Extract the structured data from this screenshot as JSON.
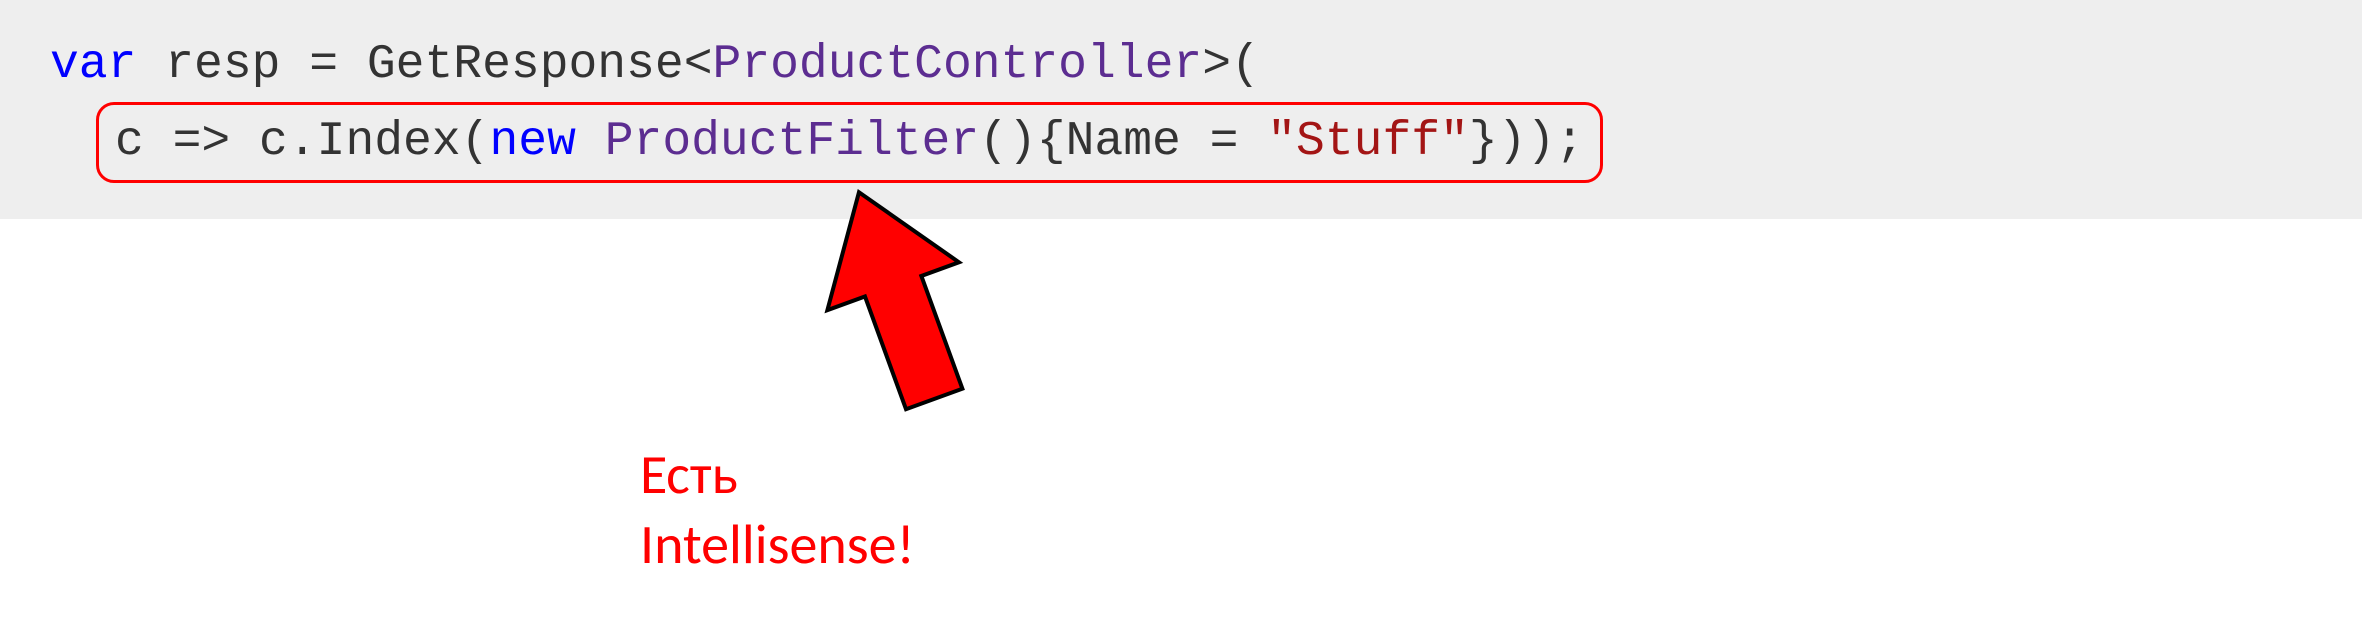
{
  "code": {
    "line1": {
      "kw_var": "var",
      "text_resp": " resp = GetResponse<",
      "type_controller": "ProductController",
      "text_close": ">("
    },
    "line2": {
      "text_lambda": "c => c.Index(",
      "kw_new": "new",
      "text_space": " ",
      "type_filter": "ProductFilter",
      "text_open": "(){Name = ",
      "str_value": "\"Stuff\"",
      "text_end": "}));"
    }
  },
  "annotation": {
    "line1": "Есть",
    "line2": "Intellisense!"
  }
}
